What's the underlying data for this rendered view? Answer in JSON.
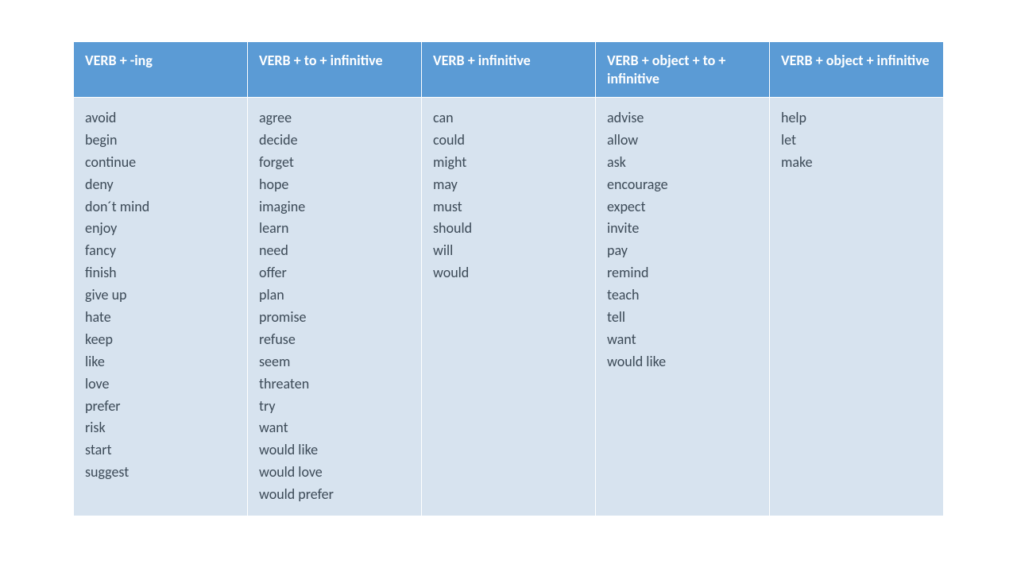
{
  "headers": [
    "VERB + -ing",
    "VERB + to + infinitive",
    "VERB + infinitive",
    "VERB + object + to + infinitive",
    "VERB + object + infinitive"
  ],
  "columns": [
    [
      "avoid",
      "begin",
      "continue",
      "deny",
      "don´t mind",
      "enjoy",
      "fancy",
      "finish",
      "give up",
      "hate",
      "keep",
      "like",
      "love",
      "prefer",
      "risk",
      "start",
      "suggest"
    ],
    [
      "agree",
      "decide",
      "forget",
      "hope",
      "imagine",
      "learn",
      "need",
      "offer",
      "plan",
      "promise",
      "refuse",
      "seem",
      "threaten",
      "try",
      "want",
      "would like",
      "would love",
      "would prefer"
    ],
    [
      "can",
      "could",
      "might",
      "may",
      "must",
      "should",
      "will",
      "would"
    ],
    [
      "advise",
      "allow",
      "ask",
      "encourage",
      "expect",
      "invite",
      "pay",
      "remind",
      "teach",
      "tell",
      "want",
      "would like"
    ],
    [
      "help",
      "let",
      "make"
    ]
  ]
}
